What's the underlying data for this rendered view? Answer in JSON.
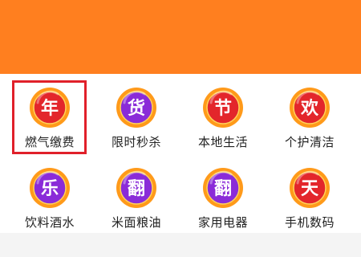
{
  "categories": [
    {
      "glyph": "年",
      "label": "燃气缴费",
      "icon": "nian-badge-icon",
      "selected": true,
      "ring": "#ff9a1a",
      "core": "#e3262b"
    },
    {
      "glyph": "货",
      "label": "限时秒杀",
      "icon": "huo-badge-icon",
      "selected": false,
      "ring": "#ff9a1a",
      "core": "#8a2bd8"
    },
    {
      "glyph": "节",
      "label": "本地生活",
      "icon": "jie-badge-icon",
      "selected": false,
      "ring": "#ff9a1a",
      "core": "#e3262b"
    },
    {
      "glyph": "欢",
      "label": "个护清洁",
      "icon": "huan-badge-icon",
      "selected": false,
      "ring": "#ff9a1a",
      "core": "#e3262b"
    },
    {
      "glyph": "乐",
      "label": "饮料酒水",
      "icon": "le-badge-icon",
      "selected": false,
      "ring": "#ff9a1a",
      "core": "#8a2bd8"
    },
    {
      "glyph": "翻",
      "label": "米面粮油",
      "icon": "fan-badge-icon",
      "selected": false,
      "ring": "#ff9a1a",
      "core": "#8a2bd8"
    },
    {
      "glyph": "翻",
      "label": "家用电器",
      "icon": "fan-badge-icon",
      "selected": false,
      "ring": "#ff9a1a",
      "core": "#8a2bd8"
    },
    {
      "glyph": "天",
      "label": "手机数码",
      "icon": "tian-badge-icon",
      "selected": false,
      "ring": "#ff9a1a",
      "core": "#e3262b"
    }
  ],
  "colors": {
    "header": "#ff7f1f",
    "highlight": "#e0202a"
  }
}
